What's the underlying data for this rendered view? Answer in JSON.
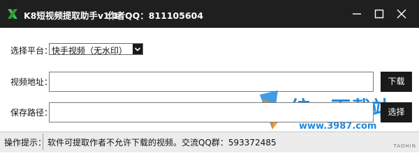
{
  "window": {
    "title": "K8短视频提取助手v1.1",
    "author": "作者QQ：811105604"
  },
  "form": {
    "platform_label": "选择平台：",
    "platform_value": "快手视频（无水印）",
    "url_label": "视频地址：",
    "url_value": "",
    "download_label": "下载",
    "save_label": "保存路径：",
    "save_value": "",
    "browse_label": "选择"
  },
  "watermark": {
    "title": "统一下载站",
    "url": "www.3987.com"
  },
  "status": {
    "label": "操作提示：",
    "message": "软件可提取作者不允许下载的视频。交流QQ群：593372485"
  },
  "corner_tag": "TAOHIN",
  "colors": {
    "titlebar": "#1f1f1f",
    "button": "#1a1a1a",
    "logo": "#3cc04a",
    "watermark": "#1e8ae0",
    "statusbar": "#ececec"
  }
}
